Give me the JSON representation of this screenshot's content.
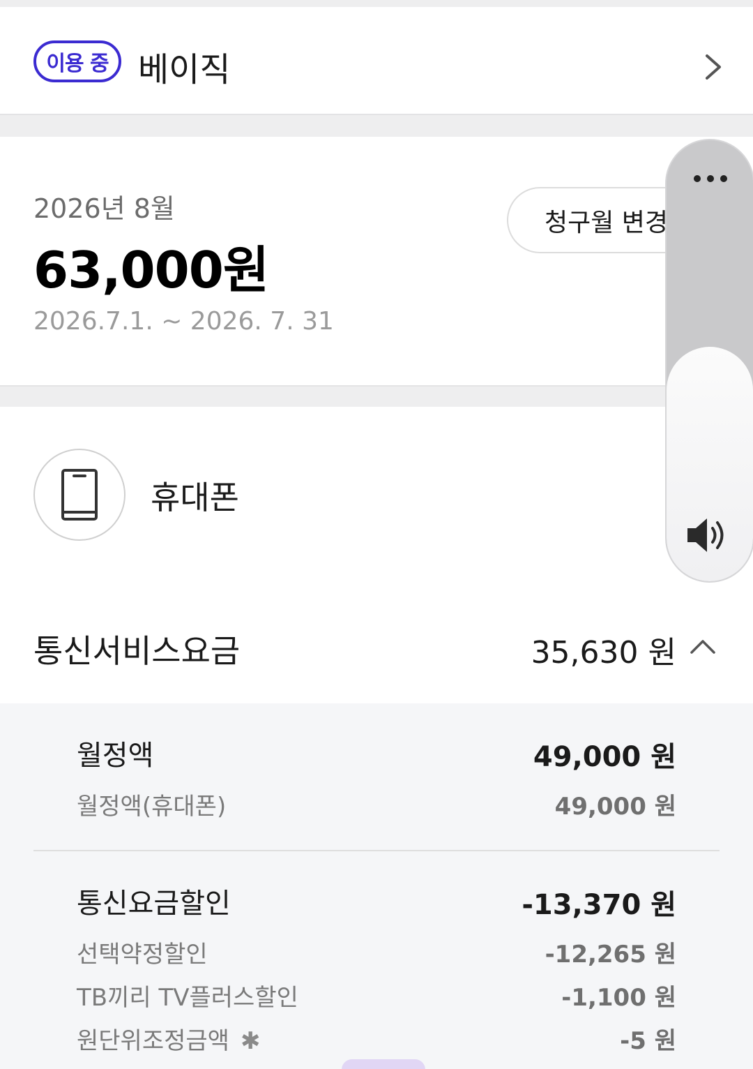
{
  "plan": {
    "badge": "이용 중",
    "name": "베이직"
  },
  "summary": {
    "month": "2026년 8월",
    "amount": "63,000원",
    "period": "2026.7.1. ~ 2026. 7. 31",
    "change_month_label": "청구월 변경"
  },
  "device": {
    "name": "휴대폰"
  },
  "service_fee": {
    "label": "통신서비스요금",
    "amount": "35,630 원"
  },
  "breakdown": {
    "monthly": {
      "title": "월정액",
      "amount": "49,000 원",
      "items": [
        {
          "label": "월정액(휴대폰)",
          "amount": "49,000 원"
        }
      ]
    },
    "discount": {
      "title": "통신요금할인",
      "amount": "-13,370 원",
      "items": [
        {
          "label": "선택약정할인",
          "amount": "-12,265 원"
        },
        {
          "label": "TB끼리 TV플러스할인",
          "amount": "-1,100 원"
        },
        {
          "label": "원단위조정금액",
          "amount": "-5 원"
        }
      ]
    }
  },
  "icons": {
    "chevron": "chevron-right-icon",
    "phone": "smartphone-icon",
    "caret": "chevron-up-icon",
    "more": "more-horizontal-icon",
    "speaker": "speaker-icon"
  },
  "colors": {
    "accent": "#3b2bd1",
    "background": "#eeeeef",
    "breakdown_bg": "#f5f6f8"
  }
}
